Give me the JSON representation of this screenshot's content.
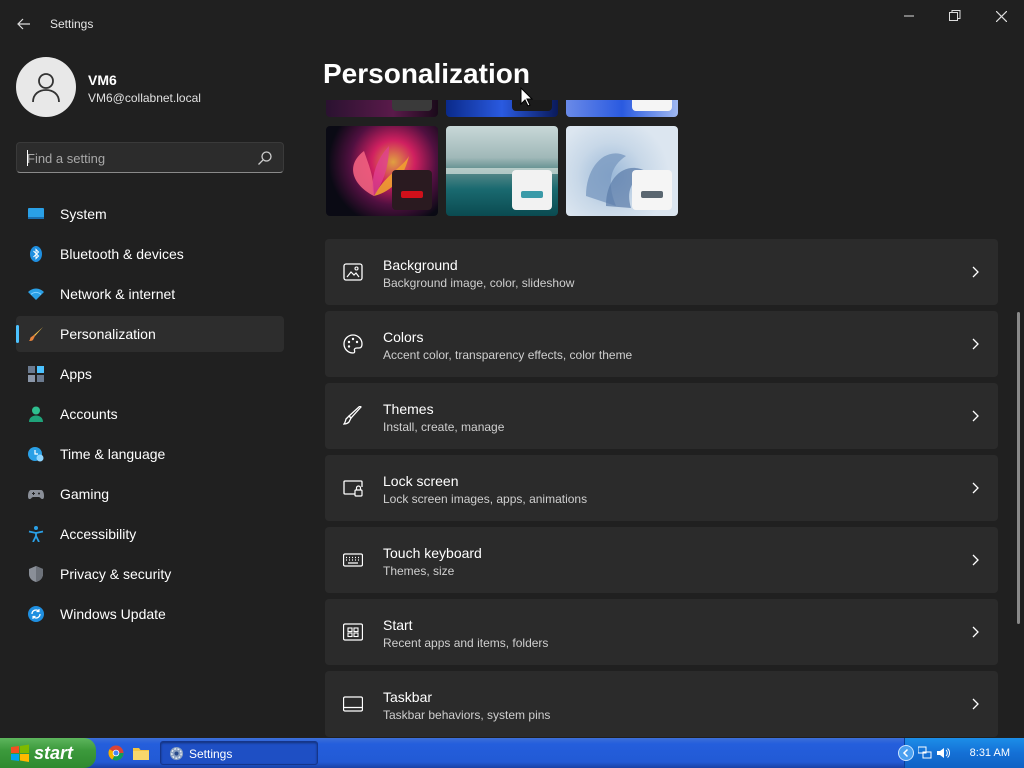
{
  "window": {
    "title": "Settings"
  },
  "profile": {
    "name": "VM6",
    "email": "VM6@collabnet.local"
  },
  "search": {
    "placeholder": "Find a setting"
  },
  "sidebar": {
    "items": [
      {
        "label": "System",
        "icon": "system-icon",
        "active": false
      },
      {
        "label": "Bluetooth & devices",
        "icon": "bluetooth-icon",
        "active": false
      },
      {
        "label": "Network & internet",
        "icon": "wifi-icon",
        "active": false
      },
      {
        "label": "Personalization",
        "icon": "brush-icon",
        "active": true
      },
      {
        "label": "Apps",
        "icon": "apps-icon",
        "active": false
      },
      {
        "label": "Accounts",
        "icon": "accounts-icon",
        "active": false
      },
      {
        "label": "Time & language",
        "icon": "clock-icon",
        "active": false
      },
      {
        "label": "Gaming",
        "icon": "gamepad-icon",
        "active": false
      },
      {
        "label": "Accessibility",
        "icon": "accessibility-icon",
        "active": false
      },
      {
        "label": "Privacy & security",
        "icon": "shield-icon",
        "active": false
      },
      {
        "label": "Windows Update",
        "icon": "update-icon",
        "active": false
      }
    ]
  },
  "main": {
    "title": "Personalization",
    "cards": [
      {
        "title": "Background",
        "subtitle": "Background image, color, slideshow",
        "icon": "image-icon"
      },
      {
        "title": "Colors",
        "subtitle": "Accent color, transparency effects, color theme",
        "icon": "palette-icon"
      },
      {
        "title": "Themes",
        "subtitle": "Install, create, manage",
        "icon": "brush-icon"
      },
      {
        "title": "Lock screen",
        "subtitle": "Lock screen images, apps, animations",
        "icon": "lock-screen-icon"
      },
      {
        "title": "Touch keyboard",
        "subtitle": "Themes, size",
        "icon": "keyboard-icon"
      },
      {
        "title": "Start",
        "subtitle": "Recent apps and items, folders",
        "icon": "start-icon"
      },
      {
        "title": "Taskbar",
        "subtitle": "Taskbar behaviors, system pins",
        "icon": "taskbar-icon"
      }
    ]
  },
  "taskbar": {
    "start_label": "start",
    "task_label": "Settings",
    "clock": "8:31 AM"
  },
  "colors": {
    "accent": "#4cc2ff",
    "taskbar_blue": "#245edc",
    "start_green": "#3c9a3c"
  }
}
